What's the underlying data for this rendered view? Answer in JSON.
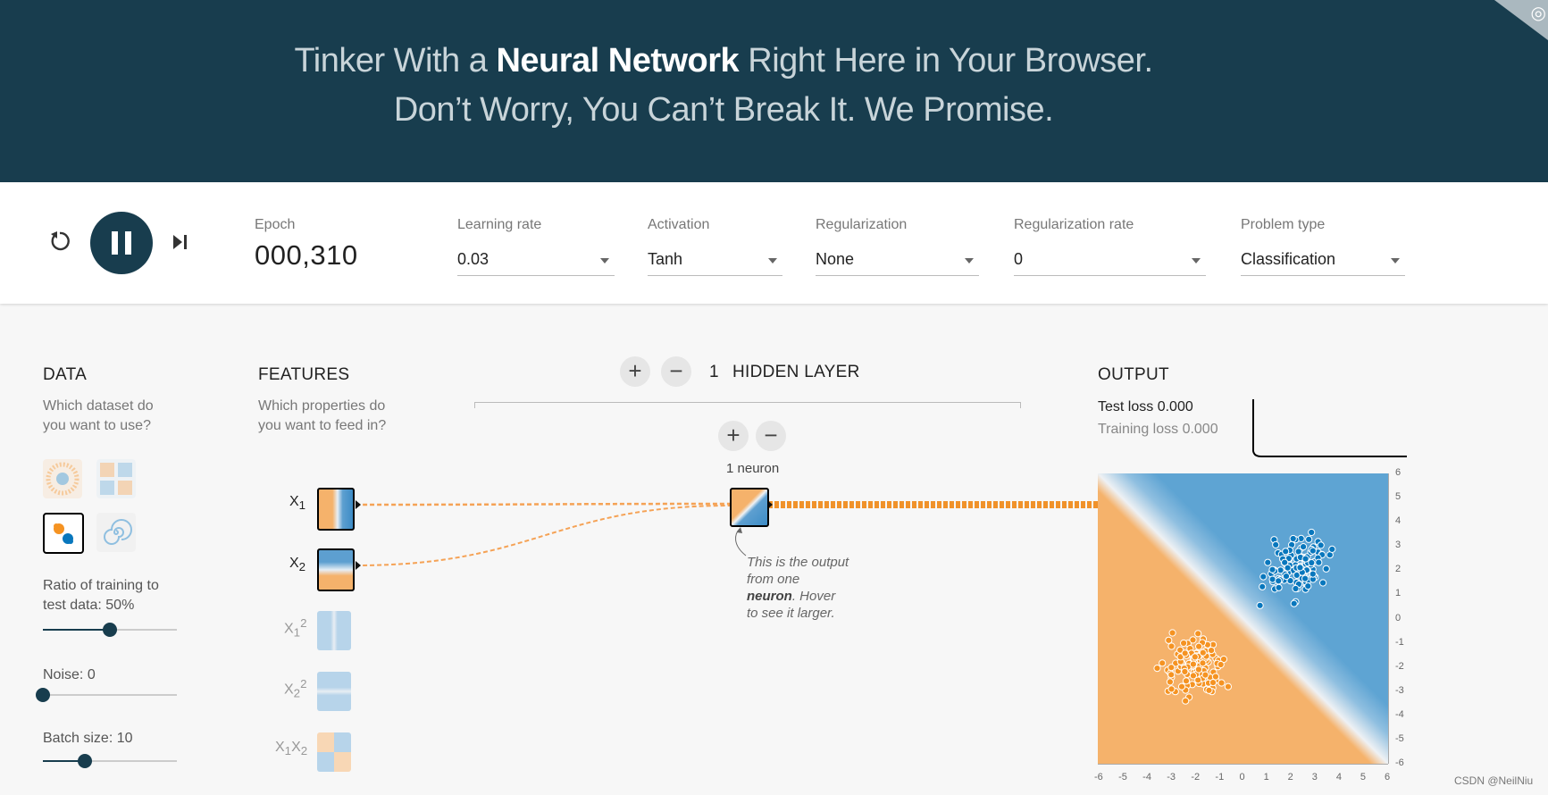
{
  "header": {
    "line1_prefix": "Tinker With a ",
    "line1_bold": "Neural Network",
    "line1_suffix": " Right Here in Your Browser.",
    "line2": "Don’t Worry, You Can’t Break It. We Promise."
  },
  "controls": {
    "reset_icon": "reset-icon",
    "pause_icon": "pause-icon",
    "step_icon": "step-icon",
    "epoch_label": "Epoch",
    "epoch_value": "000,310",
    "learning_rate": {
      "label": "Learning rate",
      "value": "0.03"
    },
    "activation": {
      "label": "Activation",
      "value": "Tanh"
    },
    "regularization": {
      "label": "Regularization",
      "value": "None"
    },
    "regularization_rate": {
      "label": "Regularization rate",
      "value": "0"
    },
    "problem_type": {
      "label": "Problem type",
      "value": "Classification"
    }
  },
  "data_panel": {
    "title": "DATA",
    "subtitle_1": "Which dataset do",
    "subtitle_2": "you want to use?",
    "ratio_label": "Ratio of training to",
    "ratio_label2": "test data:",
    "ratio_value": "50%",
    "ratio_fraction": 0.5,
    "noise_label": "Noise:",
    "noise_value": "0",
    "noise_fraction": 0,
    "batch_label": "Batch size:",
    "batch_value": "10",
    "batch_fraction": 0.31
  },
  "features_panel": {
    "title": "FEATURES",
    "subtitle_1": "Which properties do",
    "subtitle_2": "you want to feed in?",
    "features": [
      {
        "base": "X",
        "sub": "1",
        "sup": "",
        "active": true
      },
      {
        "base": "X",
        "sub": "2",
        "sup": "",
        "active": true
      },
      {
        "base": "X",
        "sub": "1",
        "sup": "2",
        "active": false
      },
      {
        "base": "X",
        "sub": "2",
        "sup": "2",
        "active": false
      },
      {
        "base": "X",
        "sub": "1",
        "base2": "X",
        "sub2": "2",
        "active": false
      }
    ]
  },
  "network": {
    "layer_count": "1",
    "layer_label": "HIDDEN LAYER",
    "neuron_label": "1 neuron",
    "note_1": "This is the output",
    "note_2": "from one",
    "note_bold": "neuron",
    "note_3": ". Hover",
    "note_4": "to see it larger."
  },
  "output_panel": {
    "title": "OUTPUT",
    "test_loss_label": "Test loss",
    "test_loss_value": "0.000",
    "training_loss_label": "Training loss",
    "training_loss_value": "0.000",
    "x_ticks": [
      "-6",
      "-5",
      "-4",
      "-3",
      "-2",
      "-1",
      "0",
      "1",
      "2",
      "3",
      "4",
      "5",
      "6"
    ],
    "y_ticks": [
      "6",
      "5",
      "4",
      "3",
      "2",
      "1",
      "0",
      "-1",
      "-2",
      "-3",
      "-4",
      "-5",
      "-6"
    ]
  },
  "colors": {
    "orange": "#f59322",
    "blue": "#0877bd",
    "dark": "#183d4e"
  },
  "watermark": "CSDN @NeilNiu"
}
